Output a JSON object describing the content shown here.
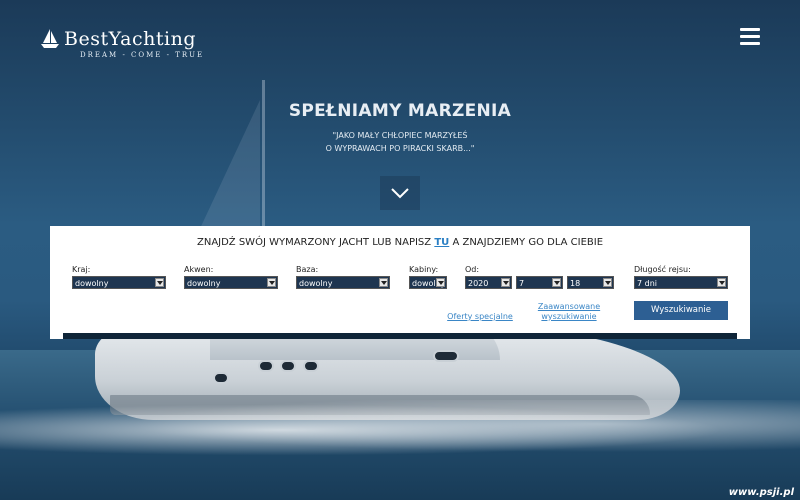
{
  "brand": {
    "name": "BestYachting",
    "tagline": "DREAM - COME - TRUE"
  },
  "hero": {
    "title": "SPEŁNIAMY MARZENIA",
    "quote_line1": "\"JAKO MAŁY CHŁOPIEC MARZYŁEŚ",
    "quote_line2": "O WYPRAWACH PO PIRACKI SKARB...\""
  },
  "search": {
    "title_before": "ZNAJDŹ SWÓJ WYMARZONY JACHT LUB NAPISZ ",
    "title_link": "TU",
    "title_after": " A ZNAJDZIEMY GO DLA CIEBIE",
    "fields": {
      "country": {
        "label": "Kraj:",
        "value": "dowolny"
      },
      "area": {
        "label": "Akwen:",
        "value": "dowolny"
      },
      "base": {
        "label": "Baza:",
        "value": "dowolny"
      },
      "cabins": {
        "label": "Kabiny:",
        "value": "dowolny"
      },
      "from": {
        "label": "Od:",
        "year": "2020",
        "month": "7",
        "day": "18"
      },
      "duration": {
        "label": "Długość rejsu:",
        "value": "7 dni"
      }
    },
    "special_offers": "Oferty specjalne",
    "advanced_line1": "Zaawansowane",
    "advanced_line2": "wyszukiwanie",
    "submit": "Wyszukiwanie"
  },
  "watermark": "www.psji.pl",
  "icons": {
    "menu": "hamburger-icon",
    "scroll": "chevron-down-icon",
    "logo": "sailboat-icon",
    "dropdown": "dropdown-caret-icon"
  },
  "colors": {
    "accent": "#2d5f93",
    "link": "#2a7fc4",
    "select_bg": "#1e3550"
  }
}
